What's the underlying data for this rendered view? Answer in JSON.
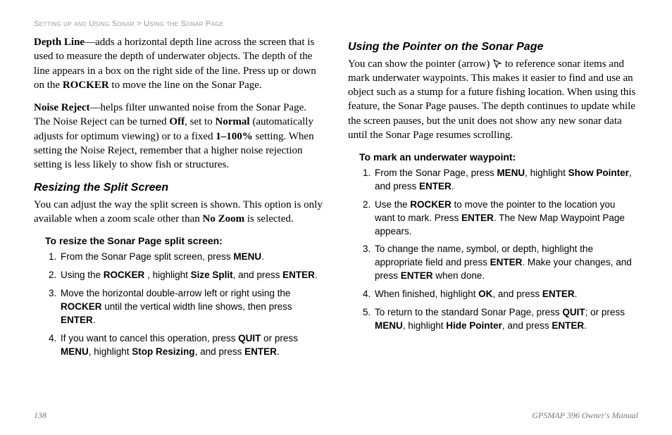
{
  "header": {
    "section": "Setting up and Using Sonar",
    "sep": " > ",
    "page": "Using the Sonar Page"
  },
  "depthLine": {
    "term": "Depth Line",
    "body1": "—adds a horizontal depth line across the screen that is used to measure the depth of underwater objects. The depth of the line appears in a box on the right side of the line. Press up or down on the ",
    "rocker": "ROCKER",
    "body2": " to move the line on the Sonar Page."
  },
  "noiseReject": {
    "term": "Noise Reject",
    "body1": "—helps filter unwanted noise from the Sonar Page. The Noise Reject can be turned ",
    "off": "Off",
    "body2": ", set to ",
    "normal": "Normal",
    "body3": " (automatically adjusts for optimum viewing) or to a fixed ",
    "range": "1–100%",
    "body4": " setting. When setting the Noise Reject, remember that a higher noise rejection setting is less likely to show fish or structures."
  },
  "resize": {
    "heading": "Resizing the Split Screen",
    "intro1": "You can adjust the way the split screen is shown. This option is only available when a zoom scale other than ",
    "noZoom": "No Zoom",
    "intro2": " is selected.",
    "sub": "To resize the Sonar Page split screen:",
    "steps": {
      "s1a": "From the Sonar Page split screen, press ",
      "s1b": "MENU",
      "s1c": ".",
      "s2a": "Using the ",
      "s2b": "ROCKER",
      "s2c": " , highlight ",
      "s2d": "Size Split",
      "s2e": ", and press ",
      "s2f": "ENTER",
      "s2g": ".",
      "s3a": "Move the horizontal double-arrow left or right using the ",
      "s3b": "ROCKER",
      "s3c": " until the vertical width line shows, then press ",
      "s3d": "ENTER",
      "s3e": ".",
      "s4a": "If you want to cancel this operation, press ",
      "s4b": "QUIT",
      "s4c": " or press ",
      "s4d": "MENU",
      "s4e": ", highlight ",
      "s4f": "Stop Resizing",
      "s4g": ", and press ",
      "s4h": "ENTER",
      "s4i": "."
    }
  },
  "pointer": {
    "heading": "Using the Pointer on the Sonar Page",
    "p1a": "You can show the pointer (arrow) ",
    "p1b": " to reference sonar items and mark underwater waypoints. This makes it easier to find and use an object such as a stump for a future fishing location. When using this feature, the Sonar Page pauses. The depth continues to update while the screen pauses, but the unit does not show any new sonar data until the Sonar Page resumes scrolling.",
    "sub": "To mark an underwater waypoint:",
    "steps": {
      "s1a": "From the Sonar Page, press ",
      "s1b": "MENU",
      "s1c": ", highlight ",
      "s1d": "Show Pointer",
      "s1e": ", and press ",
      "s1f": "ENTER",
      "s1g": ".",
      "s2a": "Use the ",
      "s2b": "ROCKER",
      "s2c": " to move the pointer to the location you want to mark. Press ",
      "s2d": "ENTER",
      "s2e": ". The New Map Waypoint Page appears.",
      "s3a": "To change the name, symbol, or depth, highlight the appropriate field and press ",
      "s3b": "ENTER",
      "s3c": ". Make your changes, and press ",
      "s3d": "ENTER",
      "s3e": " when done.",
      "s4a": "When finished, highlight ",
      "s4b": "OK",
      "s4c": ", and press ",
      "s4d": "ENTER",
      "s4e": ".",
      "s5a": "To return to the standard Sonar Page, press ",
      "s5b": "QUIT",
      "s5c": "; or press ",
      "s5d": "MENU",
      "s5e": ", highlight ",
      "s5f": "Hide Pointer",
      "s5g": ", and press ",
      "s5h": "ENTER",
      "s5i": "."
    }
  },
  "footer": {
    "pageNum": "138",
    "manual": "GPSMAP 396 Owner's Manual"
  }
}
